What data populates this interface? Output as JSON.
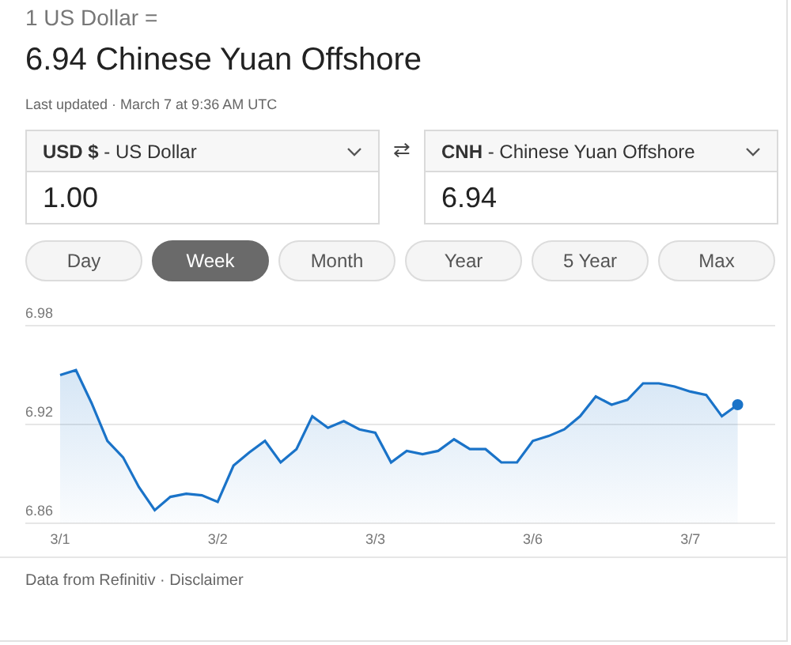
{
  "header": {
    "base": "1 US Dollar =",
    "result": "6.94 Chinese Yuan Offshore",
    "updated": "Last updated · March 7 at 9:36 AM UTC"
  },
  "converter": {
    "swap": "⇄",
    "from": {
      "code": "USD $",
      "name": " - US Dollar",
      "value": "1.00"
    },
    "to": {
      "code": "CNH",
      "name": " - Chinese Yuan Offshore",
      "value": "6.94"
    }
  },
  "ranges": [
    {
      "label": "Day",
      "selected": false
    },
    {
      "label": "Week",
      "selected": true
    },
    {
      "label": "Month",
      "selected": false
    },
    {
      "label": "Year",
      "selected": false
    },
    {
      "label": "5 Year",
      "selected": false
    },
    {
      "label": "Max",
      "selected": false
    }
  ],
  "chart_data": {
    "type": "area",
    "ylim": [
      6.86,
      6.98
    ],
    "yticks": [
      6.86,
      6.92,
      6.98
    ],
    "categories": [
      "3/1",
      null,
      null,
      null,
      null,
      null,
      null,
      null,
      null,
      null,
      "3/2",
      null,
      null,
      null,
      null,
      null,
      null,
      null,
      null,
      null,
      "3/3",
      null,
      null,
      null,
      null,
      null,
      null,
      null,
      null,
      null,
      "3/6",
      null,
      null,
      null,
      null,
      null,
      null,
      null,
      null,
      null,
      "3/7",
      null,
      null,
      null
    ],
    "series": [
      {
        "color": "#1a73c8",
        "values": [
          6.95,
          6.953,
          6.933,
          6.91,
          6.9,
          6.882,
          6.868,
          6.876,
          6.878,
          6.877,
          6.873,
          6.895,
          6.903,
          6.91,
          6.897,
          6.905,
          6.925,
          6.918,
          6.922,
          6.917,
          6.915,
          6.897,
          6.904,
          6.902,
          6.904,
          6.911,
          6.905,
          6.905,
          6.897,
          6.897,
          6.91,
          6.913,
          6.917,
          6.925,
          6.937,
          6.932,
          6.935,
          6.945,
          6.945,
          6.943,
          6.94,
          6.938,
          6.925,
          6.932
        ]
      }
    ]
  },
  "footer": {
    "source": "Data from Refinitiv",
    "separator": " · ",
    "link": "Disclaimer"
  }
}
